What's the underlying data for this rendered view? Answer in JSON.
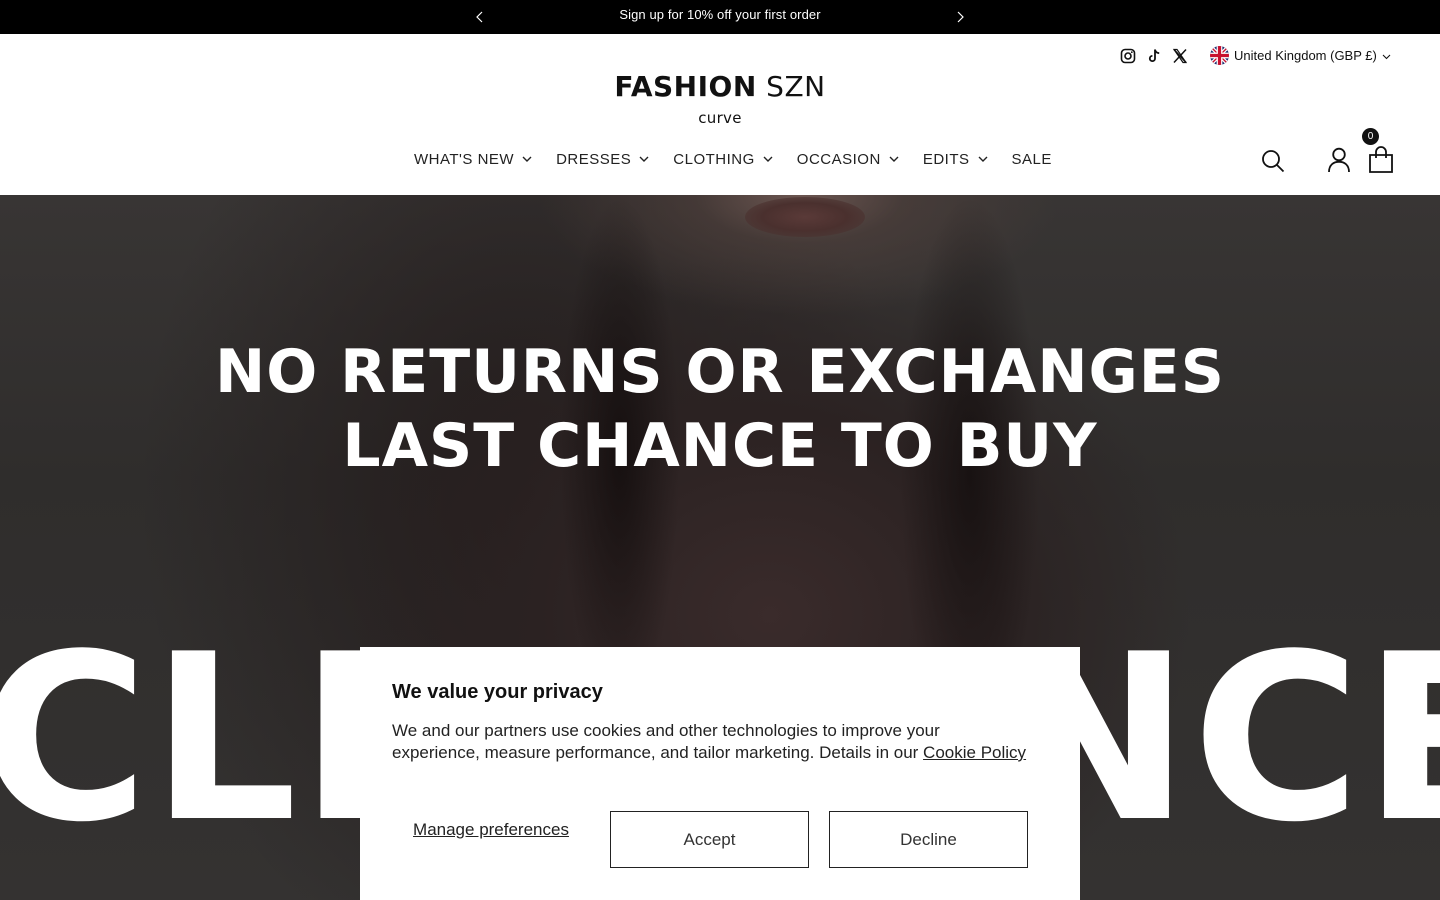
{
  "announcement": {
    "message": "Sign up for 10% off your first order",
    "prev_icon": "chevron-left-icon",
    "next_icon": "chevron-right-icon"
  },
  "header": {
    "social_icons": [
      "instagram-icon",
      "tiktok-icon",
      "x-icon"
    ],
    "country_selector": "United Kingdom (GBP £)",
    "logo": {
      "bold": "FASHION",
      "light": "SZN",
      "sub": "curve"
    },
    "nav": [
      {
        "label": "WHAT'S NEW",
        "has_dropdown": true
      },
      {
        "label": "DRESSES",
        "has_dropdown": true
      },
      {
        "label": "CLOTHING",
        "has_dropdown": true
      },
      {
        "label": "OCCASION",
        "has_dropdown": true
      },
      {
        "label": "EDITS",
        "has_dropdown": true
      },
      {
        "label": "SALE",
        "has_dropdown": false
      }
    ],
    "icons": [
      "search-icon",
      "account-icon",
      "cart-icon"
    ],
    "cart_count": "0"
  },
  "hero": {
    "line1": "NO RETURNS OR EXCHANGES",
    "line2": "LAST CHANCE TO BUY",
    "big_text": "CLEARANCE"
  },
  "cookie": {
    "title": "We value your privacy",
    "body": "We and our partners use cookies and other technologies to improve your experience, measure performance, and tailor marketing. Details in our ",
    "link": "Cookie Policy",
    "manage": "Manage preferences",
    "accept": "Accept",
    "decline": "Decline"
  },
  "colors": {
    "announcement_bg": "#000000",
    "text": "#111111",
    "hero_overlay": "#353331"
  }
}
